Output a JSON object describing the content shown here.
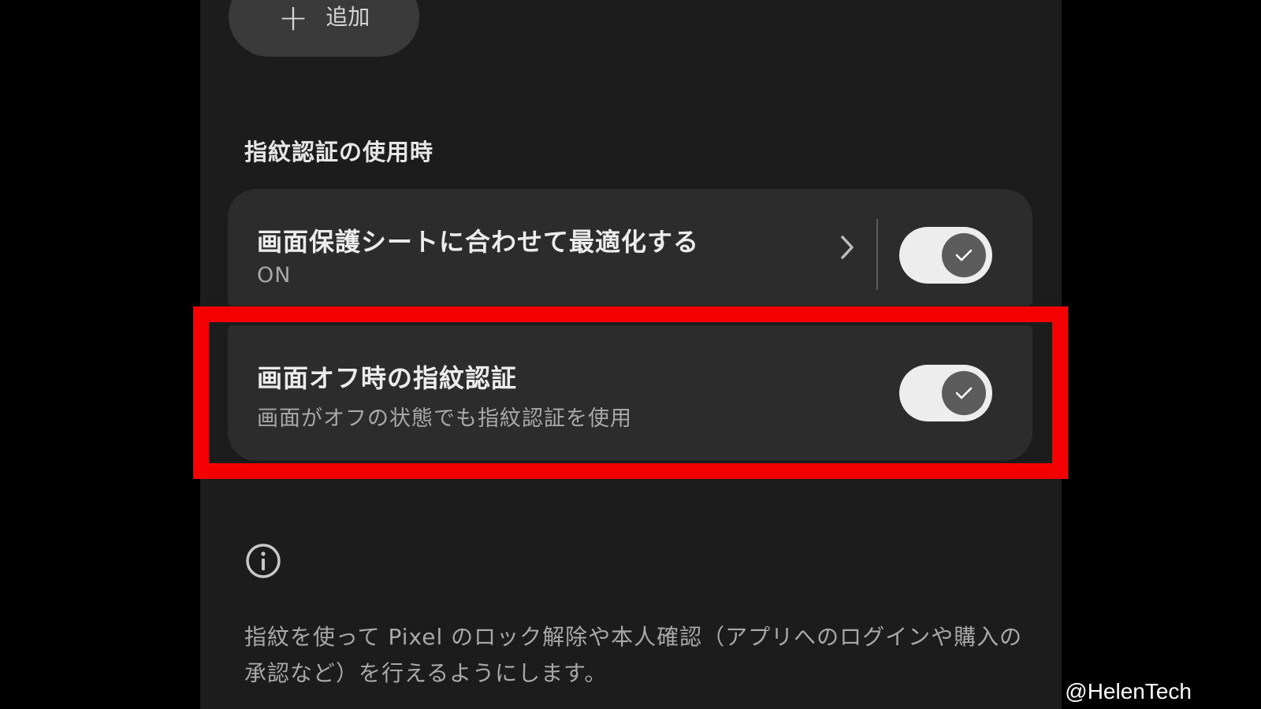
{
  "add_button": {
    "plus": "+",
    "label": "追加"
  },
  "section": {
    "title": "指紋認証の使用時"
  },
  "settings": [
    {
      "title": "画面保護シートに合わせて最適化する",
      "subtitle": "ON",
      "has_chevron": true,
      "toggle_on": true
    },
    {
      "title": "画面オフ時の指紋認証",
      "subtitle": "画面がオフの状態でも指紋認証を使用",
      "has_chevron": false,
      "toggle_on": true
    }
  ],
  "info": {
    "icon": "info-icon",
    "text": "指紋を使って Pixel のロック解除や本人確認（アプリへのログインや購入の承認など）を行えるようにします。"
  },
  "watermark": "@HelenTech",
  "colors": {
    "highlight": "#f40000",
    "toggle_track": "#ededed",
    "toggle_thumb": "#5c5c5c"
  }
}
